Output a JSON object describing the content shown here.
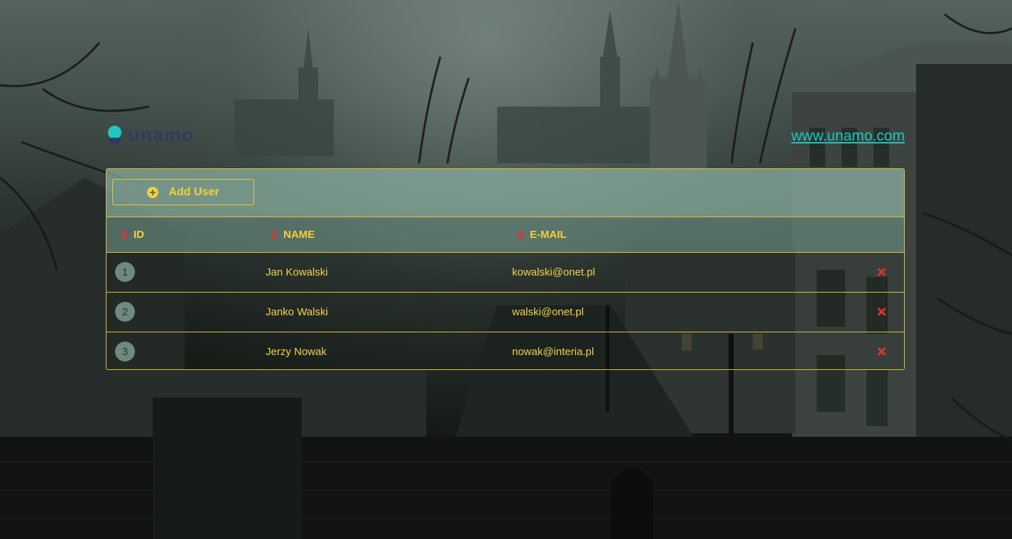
{
  "header": {
    "logo_text": "unamo",
    "site_link": "www.unamo.com"
  },
  "toolbar": {
    "add_user_label": "Add User"
  },
  "table": {
    "columns": [
      {
        "label": "ID"
      },
      {
        "label": "NAME"
      },
      {
        "label": "E-MAIL"
      }
    ],
    "rows": [
      {
        "id": "1",
        "name": "Jan Kowalski",
        "email": "kowalski@onet.pl"
      },
      {
        "id": "2",
        "name": "Janko Walski",
        "email": "walski@onet.pl"
      },
      {
        "id": "3",
        "name": "Jerzy Nowak",
        "email": "nowak@interia.pl"
      }
    ]
  },
  "colors": {
    "accent": "#f2d13a",
    "link": "#1cc7c0",
    "delete": "#d83434",
    "border": "#d8c23a"
  }
}
